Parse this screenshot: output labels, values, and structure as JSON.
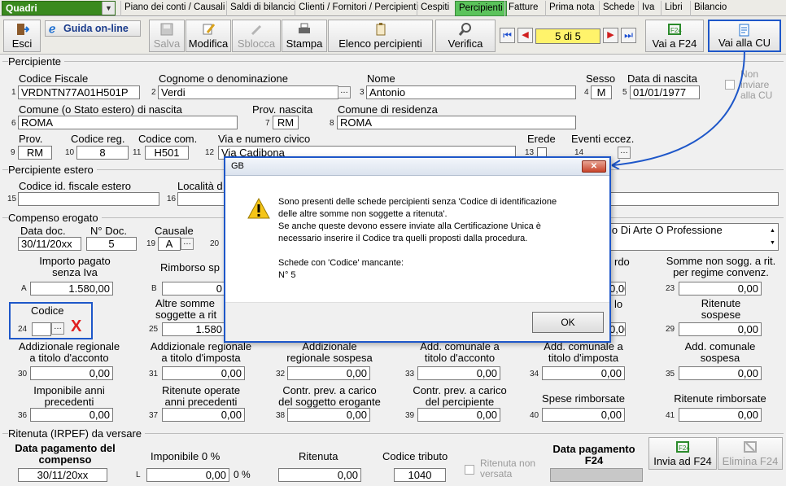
{
  "menu": {
    "combo_value": "Quadri",
    "tabs": [
      "Piano dei conti / Causali",
      "Saldi di bilancio",
      "Clienti / Fornitori / Percipienti",
      "Cespiti",
      "Percipienti",
      "Fatture",
      "Prima nota",
      "Schede",
      "Iva",
      "Libri",
      "Bilancio"
    ],
    "active_tab": "Percipienti"
  },
  "toolbar": {
    "esci": "Esci",
    "guida": "Guida on-line",
    "salva": "Salva",
    "modifica": "Modifica",
    "sblocca": "Sblocca",
    "stampa": "Stampa",
    "elenco": "Elenco percipienti",
    "verifica": "Verifica",
    "record": "5 di 5",
    "vai_f24": "Vai a F24",
    "vai_cu": "Vai alla CU"
  },
  "percipiente": {
    "title": "Percipiente",
    "cf_label": "Codice Fiscale",
    "cf_num": "1",
    "cf": "VRDNTN77A01H501P",
    "cognome_label": "Cognome o denominazione",
    "cognome_num": "2",
    "cognome": "Verdi",
    "nome_label": "Nome",
    "nome_num": "3",
    "nome": "Antonio",
    "sesso_label": "Sesso",
    "sesso_num": "4",
    "sesso": "M",
    "data_nascita_label": "Data di nascita",
    "data_nascita_num": "5",
    "data_nascita": "01/01/1977",
    "non_inviare": "Non inviare alla CU",
    "comune_nascita_label": "Comune (o Stato estero) di nascita",
    "comune_nascita_num": "6",
    "comune_nascita": "ROMA",
    "prov_nascita_label": "Prov. nascita",
    "prov_nascita_num": "7",
    "prov_nascita": "RM",
    "comune_res_label": "Comune di residenza",
    "comune_res_num": "8",
    "comune_res": "ROMA",
    "prov_label": "Prov.",
    "prov_num": "9",
    "prov": "RM",
    "cod_reg_label": "Codice reg.",
    "cod_reg_num": "10",
    "cod_reg": "8",
    "cod_com_label": "Codice com.",
    "cod_com_num": "11",
    "cod_com": "H501",
    "via_label": "Via e numero civico",
    "via_num": "12",
    "via": "Via Cadibona",
    "erede_label": "Erede",
    "erede_num": "13",
    "eventi_label": "Eventi eccez.",
    "eventi_num": "14"
  },
  "estero": {
    "title": "Percipiente estero",
    "cod_label": "Codice id. fiscale estero",
    "cod_num": "15",
    "localita_label": "Località d",
    "localita_num": "16"
  },
  "compenso": {
    "title": "Compenso erogato",
    "data_doc_label": "Data doc.",
    "data_doc": "30/11/20xx",
    "n_doc_label": "N° Doc.",
    "n_doc": "5",
    "causale_label": "Causale",
    "causale_num": "19",
    "causale": "A",
    "causale_num2": "20",
    "causale_desc": "io Di Arte O Professione",
    "importo_label1": "Importo pagato",
    "importo_label2": "senza Iva",
    "importo_code": "A",
    "importo": "1.580,00",
    "rimborso_label": "Rimborso sp",
    "rimborso_code": "B",
    "rimborso": "0",
    "accordo_label": "rdo",
    "accordo": "0,00",
    "somme_label1": "Somme non sogg. a rit.",
    "somme_label2": "per regime convenz.",
    "somme_num": "23",
    "somme": "0,00",
    "codice_label": "Codice",
    "codice_num": "24",
    "altre_label1": "Altre somme",
    "altre_label2": "soggette a rit",
    "altre_num": "25",
    "altre": "1.580",
    "lo_label": "lo",
    "lo": "0,00",
    "rit_sosp_label1": "Ritenute",
    "rit_sosp_label2": "sospese",
    "rit_sosp_num": "29",
    "rit_sosp": "0,00",
    "r30_l1": "Addizionale regionale",
    "r30_l2": "a titolo d'acconto",
    "r30_n": "30",
    "r30": "0,00",
    "r31_l1": "Addizionale regionale",
    "r31_l2": "a titolo d'imposta",
    "r31_n": "31",
    "r31": "0,00",
    "r32_l1": "Addizionale",
    "r32_l2": "regionale sospesa",
    "r32_n": "32",
    "r32": "0,00",
    "r33_l1": "Add. comunale a",
    "r33_l2": "titolo d'acconto",
    "r33_n": "33",
    "r33": "0,00",
    "r34_l1": "Add. comunale a",
    "r34_l2": "titolo d'imposta",
    "r34_n": "34",
    "r34": "0,00",
    "r35_l1": "Add. comunale",
    "r35_l2": "sospesa",
    "r35_n": "35",
    "r35": "0,00",
    "r36_l1": "Imponibile anni",
    "r36_l2": "precedenti",
    "r36_n": "36",
    "r36": "0,00",
    "r37_l1": "Ritenute operate",
    "r37_l2": "anni precedenti",
    "r37_n": "37",
    "r37": "0,00",
    "r38_l1": "Contr. prev. a carico",
    "r38_l2": "del soggetto erogante",
    "r38_n": "38",
    "r38": "0,00",
    "r39_l1": "Contr. prev. a carico",
    "r39_l2": "del percipiente",
    "r39_n": "39",
    "r39": "0,00",
    "r40_l1": "Spese rimborsate",
    "r40_n": "40",
    "r40": "0,00",
    "r41_l1": "Ritenute rimborsate",
    "r41_n": "41",
    "r41": "0,00"
  },
  "ritenuta": {
    "title": "Ritenuta (IRPEF) da versare",
    "data_pag_label1": "Data pagamento del",
    "data_pag_label2": "compenso",
    "data_pag": "30/11/20xx",
    "imponibile_label": "Imponibile 0 %",
    "imponibile_code": "L",
    "imponibile": "0,00",
    "perc": "0 %",
    "ritenuta_label": "Ritenuta",
    "ritenuta": "0,00",
    "cod_tributo_label": "Codice tributo",
    "cod_tributo": "1040",
    "non_versata": "Ritenuta non versata",
    "data_f24_label1": "Data pagamento",
    "data_f24_label2": "F24",
    "invia_f24": "Invia ad F24",
    "elimina_f24": "Elimina F24"
  },
  "dialog": {
    "title": "GB",
    "line1": "Sono presenti delle schede percipienti senza 'Codice di identificazione",
    "line2": "delle altre somme non soggette a ritenuta'.",
    "line3": "Se anche queste devono essere inviate alla Certificazione Unica è",
    "line4": "necessario inserire il Codice tra quelli proposti dalla procedura.",
    "line5": "Schede con 'Codice' mancante:",
    "line6": "N° 5",
    "ok": "OK"
  },
  "colors": {
    "accent_green": "#5bc35b",
    "highlight_blue": "#1e57c9",
    "error_red": "#e02020"
  }
}
